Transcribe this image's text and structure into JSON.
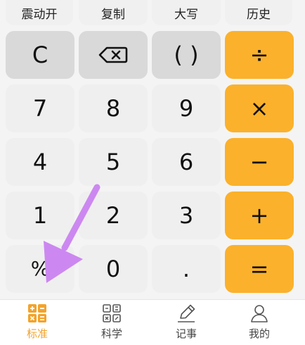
{
  "top_row": {
    "vibrate": "震动开",
    "copy": "复制",
    "uppercase": "大写",
    "history": "历史"
  },
  "keys": {
    "clear": "C",
    "parens": "( )",
    "divide": "÷",
    "seven": "7",
    "eight": "8",
    "nine": "9",
    "multiply": "×",
    "four": "4",
    "five": "5",
    "six": "6",
    "minus": "−",
    "one": "1",
    "two": "2",
    "three": "3",
    "plus": "+",
    "percent": "%",
    "zero": "0",
    "dot": ".",
    "equals": "="
  },
  "nav": {
    "standard": "标准",
    "scientific": "科学",
    "notes": "记事",
    "mine": "我的"
  },
  "colors": {
    "accent": "#fbb12b",
    "annotation_arrow": "#cc88f0"
  }
}
